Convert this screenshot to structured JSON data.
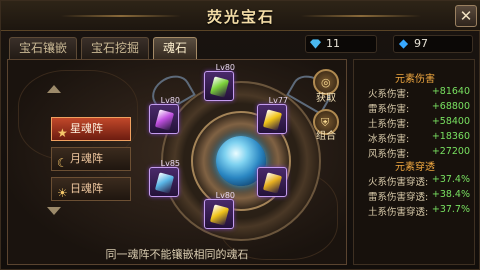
{
  "window": {
    "title": "荧光宝石",
    "close_label": "✕"
  },
  "tabs": [
    {
      "label": "宝石镶嵌",
      "active": false
    },
    {
      "label": "宝石挖掘",
      "active": false
    },
    {
      "label": "魂石",
      "active": true
    }
  ],
  "currency": {
    "diamond": {
      "icon": "blue-diamond-icon",
      "value": "11"
    },
    "crystal": {
      "icon": "blue-crystal-icon",
      "value": "97"
    }
  },
  "soul_arrays": [
    {
      "label": "星魂阵",
      "icon": "star-icon",
      "active": true
    },
    {
      "label": "月魂阵",
      "icon": "moon-icon",
      "active": false
    },
    {
      "label": "日魂阵",
      "icon": "sun-icon",
      "active": false
    }
  ],
  "gem_slots": [
    {
      "level": "Lv80",
      "gem_color": "#7cd23a"
    },
    {
      "level": "Lv77",
      "gem_color": "#f0c419"
    },
    {
      "level": "",
      "gem_color": "#e8b020"
    },
    {
      "level": "Lv80",
      "gem_color": "#f0c419"
    },
    {
      "level": "Lv85",
      "gem_color": "#5ab6e6"
    },
    {
      "level": "Lv80",
      "gem_color": "#c050e0"
    }
  ],
  "side_buttons": {
    "acquire": "获取",
    "combine": "组合"
  },
  "hint": "同一魂阵不能镶嵌相同的魂石",
  "stats": {
    "damage_title": "元素伤害",
    "damage": [
      {
        "k": "火系伤害:",
        "v": "+81640"
      },
      {
        "k": "雷系伤害:",
        "v": "+68800"
      },
      {
        "k": "土系伤害:",
        "v": "+58400"
      },
      {
        "k": "冰系伤害:",
        "v": "+18360"
      },
      {
        "k": "风系伤害:",
        "v": "+27200"
      }
    ],
    "pierce_title": "元素穿透",
    "pierce": [
      {
        "k": "火系伤害穿透:",
        "v": "+37.4%"
      },
      {
        "k": "雷系伤害穿透:",
        "v": "+38.4%"
      },
      {
        "k": "土系伤害穿透:",
        "v": "+37.7%"
      }
    ]
  },
  "colors": {
    "accent": "#f0a840",
    "stat_value": "#78e060",
    "slot_border": "#c49cf0",
    "orb": "#3ab0f0"
  }
}
